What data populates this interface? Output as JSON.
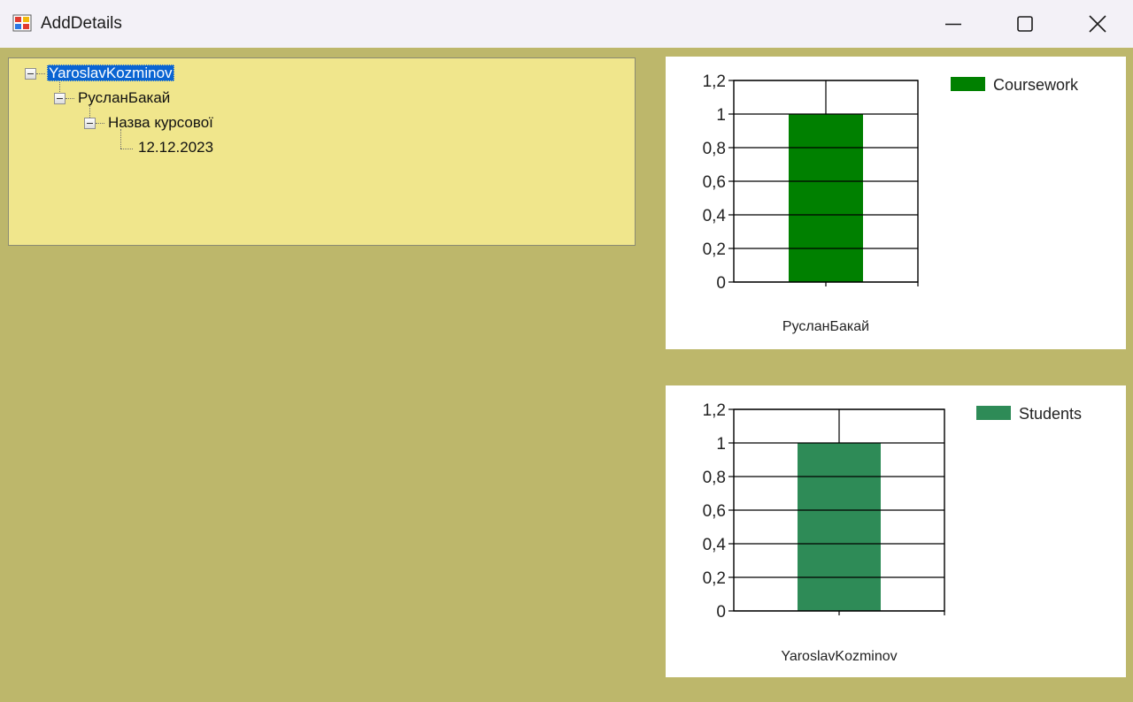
{
  "window": {
    "title": "AddDetails",
    "client_bg": "#bdb76b",
    "tree_bg": "#f0e68c"
  },
  "tree": {
    "root": {
      "label": "YaroslavKozminov",
      "expanded": true,
      "selected": true,
      "children": [
        {
          "label": "РусланБакай",
          "expanded": true,
          "children": [
            {
              "label": "Назва курсової",
              "expanded": true,
              "children": [
                {
                  "label": "12.12.2023"
                }
              ]
            }
          ]
        }
      ]
    }
  },
  "chart_data": [
    {
      "type": "bar",
      "categories": [
        "РусланБакай"
      ],
      "series": [
        {
          "name": "Coursework",
          "values": [
            1
          ],
          "color": "#008000"
        }
      ],
      "ylim": [
        0,
        1.2
      ],
      "yticks": [
        "0",
        "0,2",
        "0,4",
        "0,6",
        "0,8",
        "1",
        "1,2"
      ],
      "grid": true,
      "legend": "top-right"
    },
    {
      "type": "bar",
      "categories": [
        "YaroslavKozminov"
      ],
      "series": [
        {
          "name": "Students",
          "values": [
            1
          ],
          "color": "#2e8b57"
        }
      ],
      "ylim": [
        0,
        1.2
      ],
      "yticks": [
        "0",
        "0,2",
        "0,4",
        "0,6",
        "0,8",
        "1",
        "1,2"
      ],
      "grid": true,
      "legend": "top-right"
    }
  ]
}
